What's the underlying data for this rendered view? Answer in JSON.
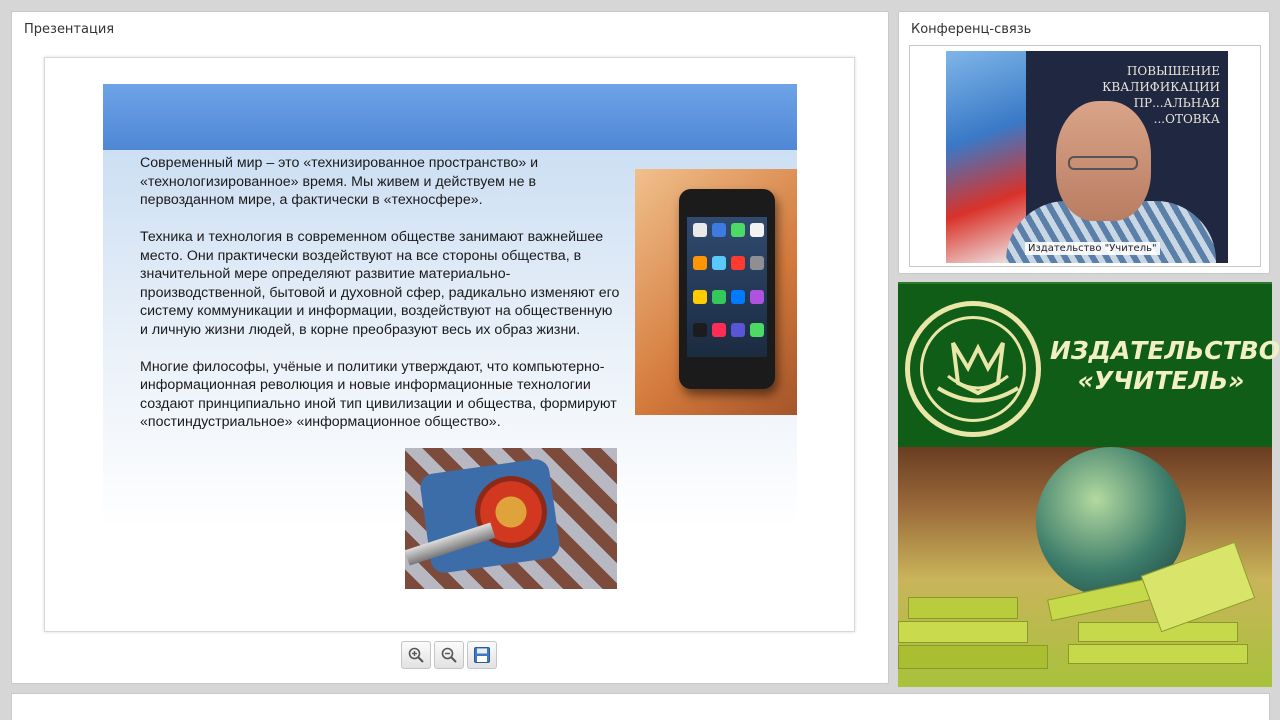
{
  "presentation": {
    "title": "Презентация",
    "slide": {
      "paragraphs": [
        "Современный мир – это «технизированное пространство» и «технологизированное» время. Мы живем и действуем не в первозданном мире, а фактически в «техносфере».",
        "Техника и технология в современном обществе занимают важнейшее место. Они практически воздействуют на все стороны общества, в значительной мере определяют развитие материально-производственной, бытовой и духовной сфер, радикально изменяют его систему коммуникации и информации, воздействуют на общественную и личную жизни людей, в корне преобразуют весь их образ жизни.",
        "Многие философы, учёные и политики утверждают, что компьютерно-информационная революция и новые информационные технологии создают принципиально иной тип цивилизации и общества, формируют «постиндустриальное» «информационное общество»."
      ]
    },
    "toolbar": {
      "zoom_in_icon": "zoom-in-icon",
      "zoom_out_icon": "zoom-out-icon",
      "save_icon": "save-icon"
    }
  },
  "conference": {
    "title": "Конференц-связь",
    "video_caption": "Издательство \"Учитель\"",
    "video_background_text": [
      "ПОВЫШЕНИЕ",
      "КВАЛИФИКАЦИИ",
      "ПР...АЛЬНАЯ",
      "...ОТОВКА"
    ]
  },
  "publisher": {
    "name_line1": "ИЗДАТЕЛЬСТВО",
    "name_line2": "«УЧИТЕЛЬ»"
  },
  "colors": {
    "slide_header": "#4f87d6",
    "publisher_green": "#0f5d17",
    "publisher_text": "#f1efc3"
  }
}
